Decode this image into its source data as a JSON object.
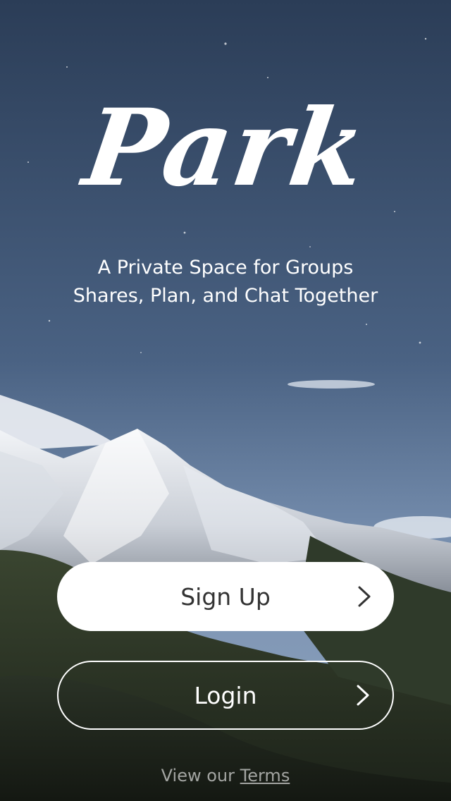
{
  "brand": {
    "logo_text": "Park"
  },
  "tagline": {
    "line1": "A Private Space for Groups",
    "line2": "Shares, Plan, and Chat Together"
  },
  "actions": {
    "signup_label": "Sign Up",
    "login_label": "Login"
  },
  "footer": {
    "terms_prefix": "View our",
    "terms_link": "Terms"
  },
  "icons": {
    "button_arrow": "chevron-right-icon"
  },
  "colors": {
    "sky_top": "#2b3d57",
    "sky_bottom": "#7b93b3",
    "text": "#ffffff",
    "signup_button_bg": "#ffffff",
    "signup_button_text": "#333333"
  }
}
